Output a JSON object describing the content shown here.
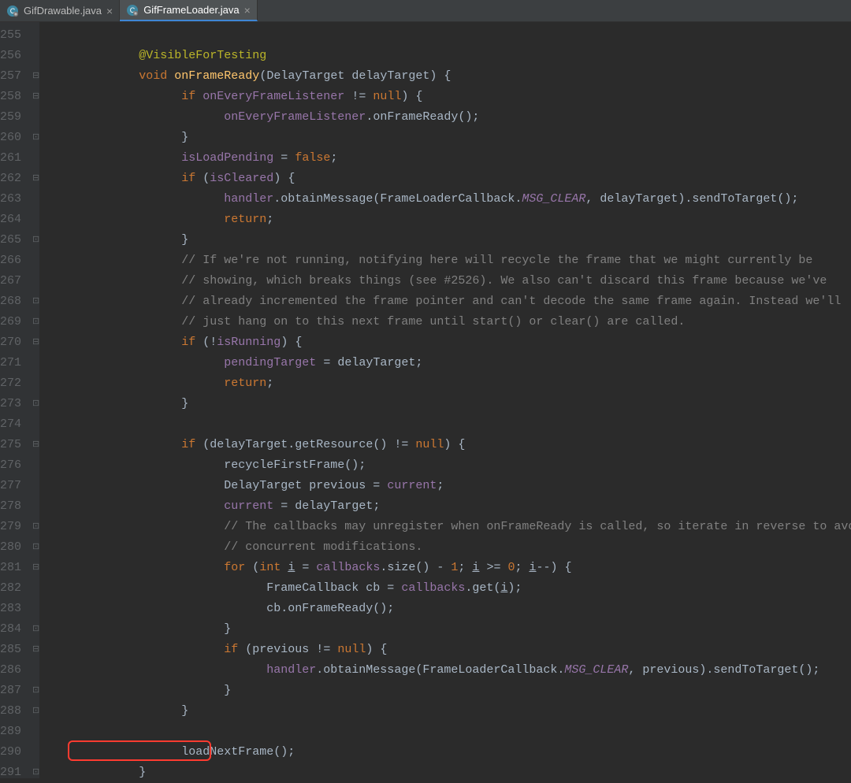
{
  "tabs": [
    {
      "label": "GifDrawable.java",
      "active": false
    },
    {
      "label": "GifFrameLoader.java",
      "active": true
    }
  ],
  "lines": {
    "start": 255,
    "count": 37
  },
  "code": {
    "l256": {
      "ann": "@VisibleForTesting"
    },
    "l257": {
      "kw1": "void ",
      "fn": "onFrameReady",
      "rest": "(DelayTarget delayTarget) {"
    },
    "l258": {
      "kw": "if ",
      "lv": "onEveryFrameListener",
      "rest": " != ",
      "kw2": "null",
      "rest2": ") {"
    },
    "l259": {
      "lv": "onEveryFrameListener",
      "rest": ".onFrameReady();"
    },
    "l260": {
      "pn": "}"
    },
    "l261": {
      "lv": "isLoadPending",
      "rest": " = ",
      "kw": "false",
      "rest2": ";"
    },
    "l262": {
      "kw": "if ",
      "rest": "(",
      "lv": "isCleared",
      "rest2": ") {"
    },
    "l263": {
      "lv": "handler",
      "rest": ".obtainMessage(FrameLoaderCallback.",
      "cnst": "MSG_CLEAR",
      "rest2": ", delayTarget).sendToTarget();"
    },
    "l264": {
      "kw": "return",
      "rest": ";"
    },
    "l265": {
      "pn": "}"
    },
    "l266": {
      "cmt": "// If we're not running, notifying here will recycle the frame that we might currently be"
    },
    "l267": {
      "cmt": "// showing, which breaks things (see #2526). We also can't discard this frame because we've"
    },
    "l268": {
      "cmt": "// already incremented the frame pointer and can't decode the same frame again. Instead we'll"
    },
    "l269": {
      "cmt": "// just hang on to this next frame until start() or clear() are called."
    },
    "l270": {
      "kw": "if ",
      "rest": "(!",
      "lv": "isRunning",
      "rest2": ") {"
    },
    "l271": {
      "lv": "pendingTarget",
      "rest": " = delayTarget;"
    },
    "l272": {
      "kw": "return",
      "rest": ";"
    },
    "l273": {
      "pn": "}"
    },
    "l275": {
      "kw": "if ",
      "rest": "(delayTarget.getResource() != ",
      "kw2": "null",
      "rest2": ") {"
    },
    "l276": {
      "rest": "recycleFirstFrame();"
    },
    "l277": {
      "rest": "DelayTarget previous = ",
      "lv": "current",
      "rest2": ";"
    },
    "l278": {
      "lv": "current",
      "rest": " = delayTarget;"
    },
    "l279": {
      "cmt": "// The callbacks may unregister when onFrameReady is called, so iterate in reverse to avoid"
    },
    "l280": {
      "cmt": "// concurrent modifications."
    },
    "l281": {
      "kw": "for ",
      "rest": "(",
      "kw2": "int ",
      "u1": "i",
      "rest2": " = ",
      "lv": "callbacks",
      "rest3": ".size() - ",
      "num": "1",
      "rest4": "; ",
      "u2": "i",
      "rest5": " >= ",
      "num2": "0",
      "rest6": "; ",
      "u3": "i",
      "rest7": "--) {"
    },
    "l282": {
      "rest": "FrameCallback cb = ",
      "lv": "callbacks",
      "rest2": ".get(",
      "u": "i",
      "rest3": ");"
    },
    "l283": {
      "rest": "cb.onFrameReady();"
    },
    "l284": {
      "pn": "}"
    },
    "l285": {
      "kw": "if ",
      "rest": "(previous != ",
      "kw2": "null",
      "rest2": ") {"
    },
    "l286": {
      "lv": "handler",
      "rest": ".obtainMessage(FrameLoaderCallback.",
      "cnst": "MSG_CLEAR",
      "rest2": ", previous).sendToTarget();"
    },
    "l287": {
      "pn": "}"
    },
    "l288": {
      "pn": "}"
    },
    "l290": {
      "rest": "loadNextFrame();"
    },
    "l291": {
      "pn": "}"
    }
  },
  "highlight": {
    "targetLine": 290
  }
}
